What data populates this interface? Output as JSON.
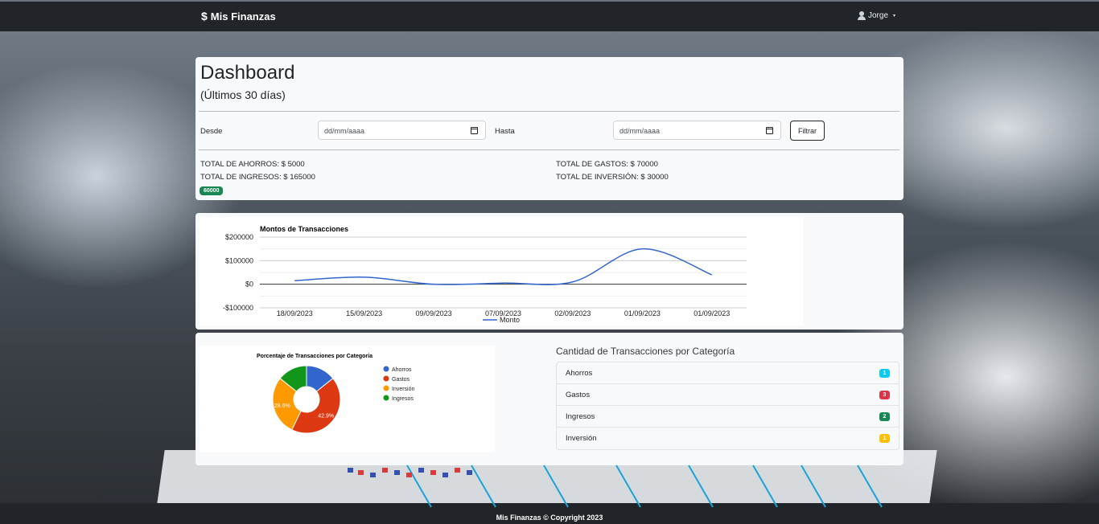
{
  "navbar": {
    "brand_icon": "$",
    "brand": "Mis Finanzas",
    "user": "Jorge",
    "caret": "▾"
  },
  "dashboard": {
    "title": "Dashboard",
    "subtitle": "(Últimos 30 días)"
  },
  "filter": {
    "from_label": "Desde",
    "from_value": "dd/mm/aaaa",
    "to_label": "Hasta",
    "to_value": "dd/mm/aaaa",
    "button_label": "Filtrar"
  },
  "totals": {
    "ahorros": "TOTAL DE AHORROS: $ 5000",
    "ingresos": "TOTAL DE INGRESOS: $ 165000",
    "gastos": "TOTAL DE GASTOS: $ 70000",
    "inversion": "TOTAL DE INVERSIÓN: $ 30000",
    "balance_badge": "60000"
  },
  "chart_data": [
    {
      "type": "line",
      "title": "Montos de Transacciones",
      "categories": [
        "18/09/2023",
        "15/09/2023",
        "09/09/2023",
        "07/09/2023",
        "02/09/2023",
        "01/09/2023",
        "01/09/2023"
      ],
      "series": [
        {
          "name": "Monto",
          "values": [
            15000,
            30000,
            0,
            5000,
            10000,
            150000,
            40000
          ],
          "color": "#3366cc"
        }
      ],
      "yticks": [
        "$200000",
        "$100000",
        "$0",
        "-$100000"
      ],
      "ylim": [
        -100000,
        200000
      ],
      "grid": true,
      "legend": "bottom"
    },
    {
      "type": "pie",
      "title": "Porcentaje de Transacciones por Categoría",
      "donut": true,
      "categories": [
        "Ahorros",
        "Gastos",
        "Inversión",
        "Ingresos"
      ],
      "values": [
        14.3,
        42.9,
        28.6,
        14.3
      ],
      "colors": [
        "#3366cc",
        "#dc3912",
        "#ff9900",
        "#109618"
      ],
      "slice_labels": [
        "",
        "42.9%",
        "28.6%",
        ""
      ],
      "legend": "right"
    }
  ],
  "categories_list": {
    "title": "Cantidad de Transacciones por Categoría",
    "items": [
      {
        "label": "Ahorros",
        "count": "1",
        "color": "#0dcaf0"
      },
      {
        "label": "Gastos",
        "count": "3",
        "color": "#dc3545"
      },
      {
        "label": "Ingresos",
        "count": "2",
        "color": "#198754"
      },
      {
        "label": "Inversión",
        "count": "1",
        "color": "#ffc107"
      }
    ]
  },
  "footer": {
    "text": "Mis Finanzas © Copyright 2023"
  }
}
